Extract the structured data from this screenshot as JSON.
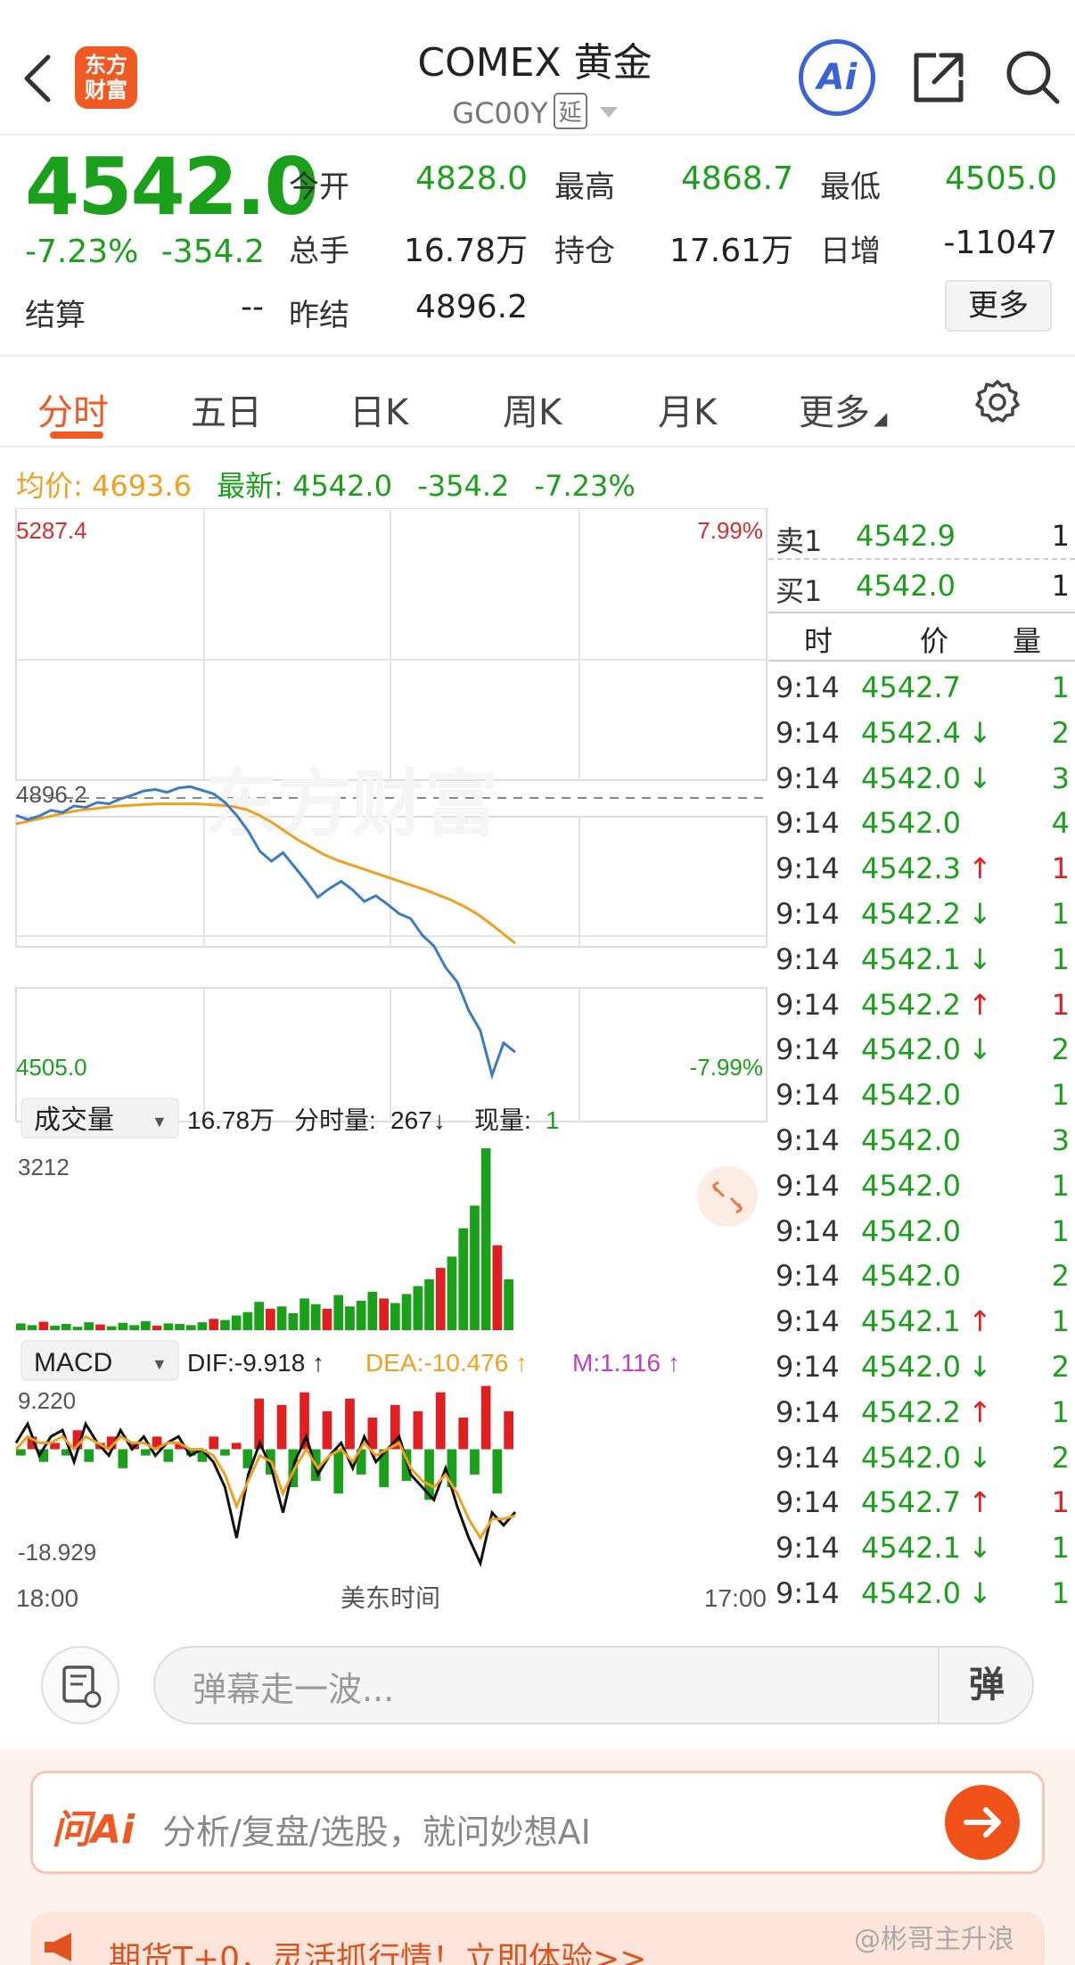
{
  "header": {
    "logo_line1": "东方",
    "logo_line2": "财富",
    "title": "COMEX 黄金",
    "code": "GC00Y",
    "delay_badge": "延",
    "ai_label": "Ai"
  },
  "quote": {
    "price": "4542.0",
    "change_pct": "-7.23%",
    "change": "-354.2",
    "stats": [
      {
        "label": "今开",
        "value": "4828.0"
      },
      {
        "label": "最高",
        "value": "4868.7"
      },
      {
        "label": "最低",
        "value": "4505.0"
      },
      {
        "label": "总手",
        "value": "16.78万"
      },
      {
        "label": "持仓",
        "value": "17.61万"
      },
      {
        "label": "日增",
        "value": "-11047"
      },
      {
        "label": "结算",
        "value": "--"
      },
      {
        "label": "昨结",
        "value": "4896.2"
      }
    ],
    "more_button": "更多"
  },
  "tabs": [
    "分时",
    "五日",
    "日K",
    "周K",
    "月K",
    "更多"
  ],
  "avg_line": {
    "avg_label": "均价:",
    "avg_value": "4693.6",
    "latest_label": "最新:",
    "latest_value": "4542.0",
    "change": "-354.2",
    "change_pct": "-7.23%"
  },
  "colors": {
    "up": "#e02020",
    "down": "#1aa01a",
    "price_line": "#3a7bc4",
    "avg_line": "#f0a020",
    "accent": "#f05a22"
  },
  "chart_data": [
    {
      "type": "line",
      "name": "price",
      "y_top_label": "5287.4",
      "y_bottom_label": "4505.0",
      "pct_top_label": "7.99%",
      "pct_bottom_label": "-7.99%",
      "ref_label": "4896.2",
      "ylim": [
        4505.0,
        5287.4
      ],
      "reference": 4896.2,
      "watermark": "东方财富",
      "series": [
        {
          "name": "price",
          "values": [
            4872,
            4866,
            4871,
            4879,
            4876,
            4885,
            4883,
            4890,
            4888,
            4895,
            4900,
            4906,
            4908,
            4904,
            4910,
            4912,
            4907,
            4902,
            4890,
            4872,
            4850,
            4822,
            4808,
            4820,
            4800,
            4780,
            4758,
            4770,
            4780,
            4768,
            4752,
            4760,
            4748,
            4735,
            4728,
            4705,
            4690,
            4660,
            4640,
            4600,
            4572,
            4510,
            4555,
            4542
          ]
        },
        {
          "name": "avg",
          "values": [
            4860,
            4864,
            4868,
            4872,
            4876,
            4879,
            4881,
            4883,
            4885,
            4886,
            4887,
            4888,
            4888,
            4888,
            4888,
            4887,
            4886,
            4884,
            4880,
            4872,
            4862,
            4850,
            4838,
            4828,
            4818,
            4810,
            4804,
            4798,
            4792,
            4786,
            4780,
            4774,
            4768,
            4761,
            4754,
            4745,
            4735,
            4722,
            4708,
            4693.6
          ]
        }
      ],
      "x_labels": {
        "start": "18:00",
        "mid": "美东时间",
        "end": "17:00"
      }
    },
    {
      "type": "bar",
      "name": "volume",
      "selector": "成交量",
      "summary_total": "16.78万",
      "summary_interval_label": "分时量:",
      "summary_interval": "267",
      "summary_current_label": "现量:",
      "summary_current": "1",
      "y_top_label": "3212",
      "ylim": [
        0,
        3212
      ],
      "values": [
        120,
        90,
        150,
        80,
        110,
        60,
        140,
        100,
        70,
        130,
        90,
        160,
        80,
        120,
        110,
        90,
        140,
        200,
        180,
        260,
        320,
        500,
        380,
        420,
        300,
        560,
        460,
        380,
        620,
        420,
        520,
        680,
        560,
        480,
        640,
        780,
        900,
        1100,
        1300,
        1800,
        2200,
        3212,
        1500,
        900
      ]
    },
    {
      "type": "bar",
      "name": "macd",
      "selector": "MACD",
      "dif_label": "DIF:-9.918 ↑",
      "dea_label": "DEA:-10.476 ↑",
      "m_label": "M:1.116 ↑",
      "y_top_label": "9.220",
      "y_bottom_label": "-18.929",
      "ylim": [
        -18.929,
        9.22
      ],
      "hist": [
        -1,
        2,
        -2,
        1,
        -1,
        3,
        -2,
        1,
        2,
        -3,
        1,
        -1,
        2,
        -2,
        1,
        -1,
        -2,
        2,
        -1,
        1,
        -3,
        8,
        -4,
        7,
        -6,
        9,
        -5,
        6,
        -7,
        8,
        -4,
        5,
        -6,
        7,
        -5,
        6,
        -8,
        9,
        -6,
        5,
        -4,
        10,
        -7,
        6
      ],
      "dif": [
        1,
        4,
        -1,
        2,
        3,
        -2,
        4,
        1,
        -1,
        3,
        0,
        2,
        -1,
        1,
        2,
        -1,
        0,
        -2,
        -6,
        -14,
        -4,
        1,
        -3,
        -10,
        -2,
        2,
        -4,
        -1,
        1,
        -3,
        2,
        -2,
        0,
        2,
        -4,
        -6,
        -8,
        -3,
        -9,
        -14,
        -18,
        -10,
        -12,
        -9.918
      ],
      "dea": [
        0,
        2,
        1,
        1,
        2,
        0,
        2,
        1,
        0,
        2,
        1,
        1,
        0,
        1,
        1,
        0,
        0,
        -1,
        -4,
        -9,
        -5,
        -1,
        -2,
        -7,
        -3,
        0,
        -3,
        -1,
        0,
        -2,
        1,
        -1,
        0,
        1,
        -3,
        -5,
        -6,
        -4,
        -7,
        -11,
        -14,
        -11,
        -11,
        -10.476
      ]
    }
  ],
  "order_book": {
    "sell": {
      "label": "卖1",
      "price": "4542.9",
      "qty": "1"
    },
    "buy": {
      "label": "买1",
      "price": "4542.0",
      "qty": "1"
    },
    "headers": [
      "时",
      "价",
      "量"
    ],
    "rows": [
      {
        "time": "9:14",
        "price": "4542.7",
        "arrow": "",
        "qty": "1",
        "qtyc": "down"
      },
      {
        "time": "9:14",
        "price": "4542.4",
        "arrow": "↓",
        "qty": "2",
        "qtyc": "down"
      },
      {
        "time": "9:14",
        "price": "4542.0",
        "arrow": "↓",
        "qty": "3",
        "qtyc": "down"
      },
      {
        "time": "9:14",
        "price": "4542.0",
        "arrow": "",
        "qty": "4",
        "qtyc": "down"
      },
      {
        "time": "9:14",
        "price": "4542.3",
        "arrow": "↑",
        "qty": "1",
        "qtyc": "up"
      },
      {
        "time": "9:14",
        "price": "4542.2",
        "arrow": "↓",
        "qty": "1",
        "qtyc": "down"
      },
      {
        "time": "9:14",
        "price": "4542.1",
        "arrow": "↓",
        "qty": "1",
        "qtyc": "down"
      },
      {
        "time": "9:14",
        "price": "4542.2",
        "arrow": "↑",
        "qty": "1",
        "qtyc": "up"
      },
      {
        "time": "9:14",
        "price": "4542.0",
        "arrow": "↓",
        "qty": "2",
        "qtyc": "down"
      },
      {
        "time": "9:14",
        "price": "4542.0",
        "arrow": "",
        "qty": "1",
        "qtyc": "down"
      },
      {
        "time": "9:14",
        "price": "4542.0",
        "arrow": "",
        "qty": "3",
        "qtyc": "down"
      },
      {
        "time": "9:14",
        "price": "4542.0",
        "arrow": "",
        "qty": "1",
        "qtyc": "down"
      },
      {
        "time": "9:14",
        "price": "4542.0",
        "arrow": "",
        "qty": "1",
        "qtyc": "down"
      },
      {
        "time": "9:14",
        "price": "4542.0",
        "arrow": "",
        "qty": "2",
        "qtyc": "down"
      },
      {
        "time": "9:14",
        "price": "4542.1",
        "arrow": "↑",
        "qty": "1",
        "qtyc": "down"
      },
      {
        "time": "9:14",
        "price": "4542.0",
        "arrow": "↓",
        "qty": "2",
        "qtyc": "down"
      },
      {
        "time": "9:14",
        "price": "4542.2",
        "arrow": "↑",
        "qty": "1",
        "qtyc": "down"
      },
      {
        "time": "9:14",
        "price": "4542.0",
        "arrow": "↓",
        "qty": "2",
        "qtyc": "down"
      },
      {
        "time": "9:14",
        "price": "4542.7",
        "arrow": "↑",
        "qty": "1",
        "qtyc": "up"
      },
      {
        "time": "9:14",
        "price": "4542.1",
        "arrow": "↓",
        "qty": "1",
        "qtyc": "down"
      },
      {
        "time": "9:14",
        "price": "4542.0",
        "arrow": "↓",
        "qty": "1",
        "qtyc": "down"
      }
    ]
  },
  "comment": {
    "placeholder": "弹幕走一波...",
    "danmu_button": "弹"
  },
  "ask_ai": {
    "logo": "问Ai",
    "placeholder": "分析/复盘/选股，就问妙想AI"
  },
  "promo": {
    "text": "期货T+0，灵活抓行情！立即体验>>"
  },
  "watermark": "@彬哥主升浪"
}
